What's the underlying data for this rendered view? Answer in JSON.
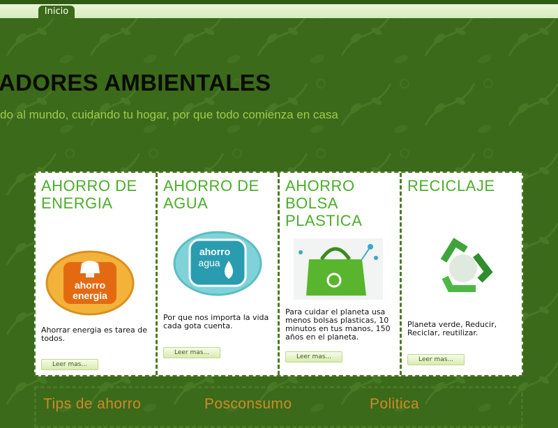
{
  "nav": {
    "items": [
      {
        "label": "Inicio"
      }
    ]
  },
  "header": {
    "title": "ADORES AMBIENTALES",
    "tagline": "do al mundo, cuidando tu hogar, por que todo comienza en casa"
  },
  "cards": [
    {
      "title": "AHORRO DE ENERGIA",
      "image_text": [
        "ahorro",
        "energia"
      ],
      "text": "Ahorrar energia es tarea de todos.",
      "button": "Leer mas..."
    },
    {
      "title": "AHORRO DE AGUA",
      "image_text": [
        "ahorro",
        "agua"
      ],
      "text": "Por que nos importa la vida cada gota cuenta.",
      "button": "Leer mas..."
    },
    {
      "title": "AHORRO BOLSA PLASTICA",
      "text": "Para cuidar el planeta usa menos bolsas plasticas, 10 minutos en tus manos, 150 años en el planeta.",
      "button": "Leer mas..."
    },
    {
      "title": "RECICLAJE",
      "text": "Planeta verde, Reducir, Reciclar, reutilizar.",
      "button": "Leer mas..."
    }
  ],
  "footer_links": [
    {
      "label": "Tips de ahorro"
    },
    {
      "label": "Posconsumo"
    },
    {
      "label": "Politica"
    }
  ],
  "colors": {
    "background": "#3a6a1a",
    "card_title": "#4cad2c",
    "tagline": "#a4c94c",
    "footer_link": "#d08a28"
  }
}
